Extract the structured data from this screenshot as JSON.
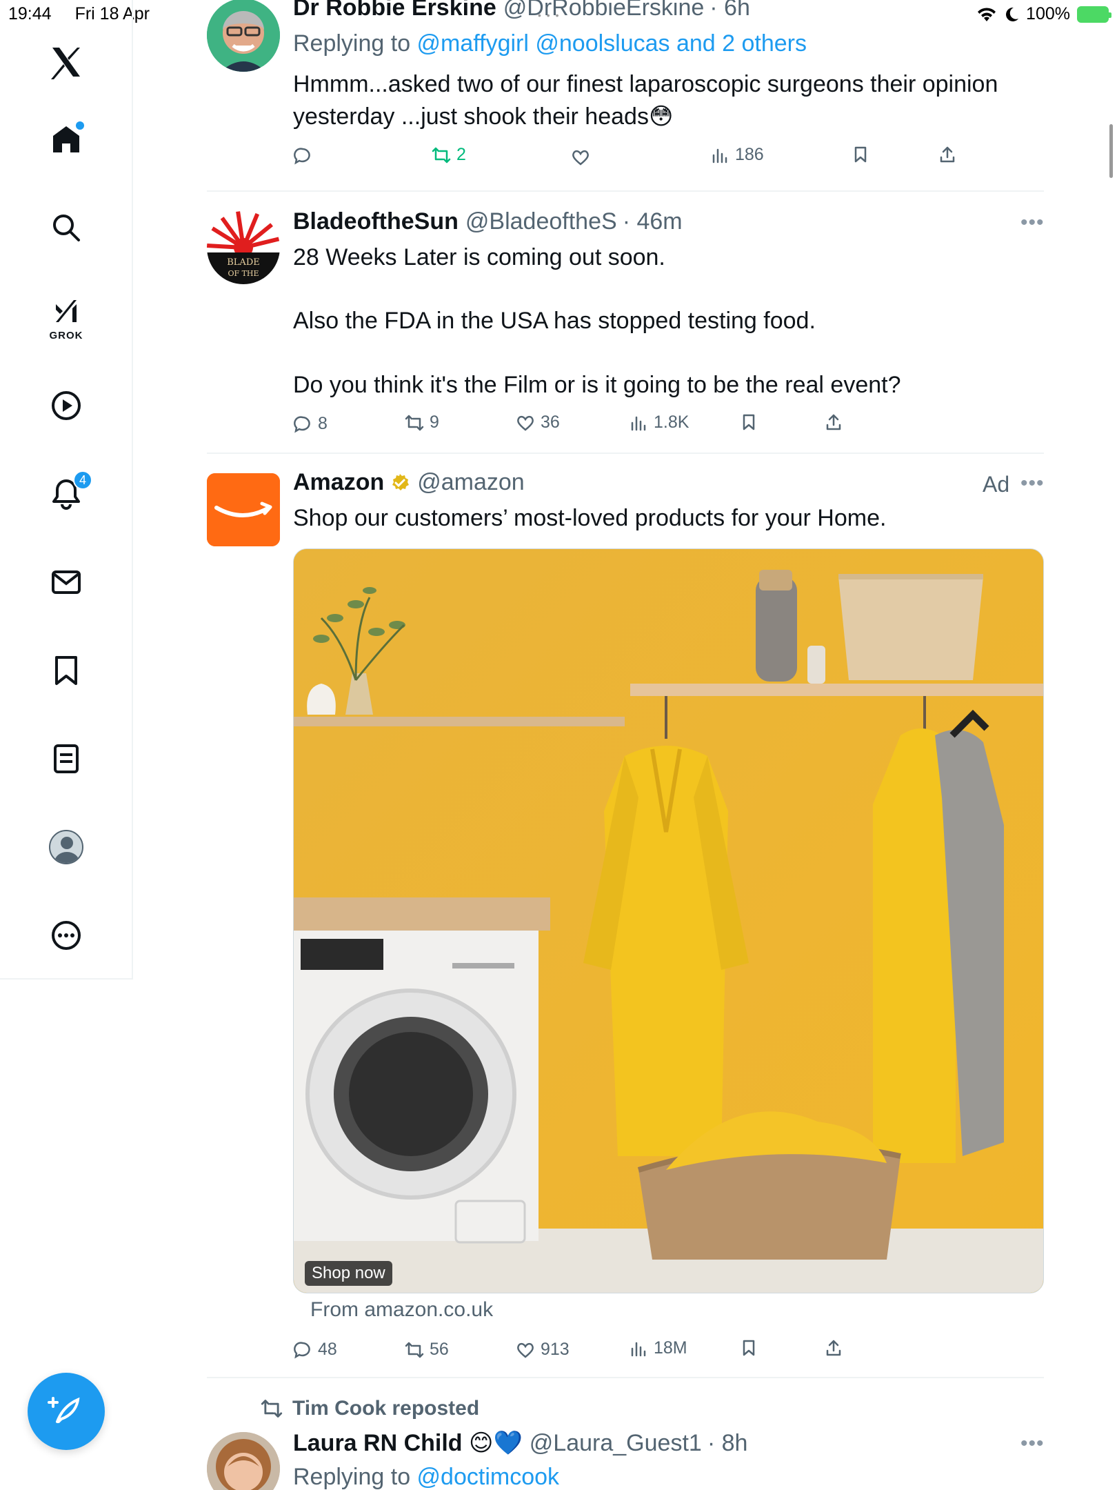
{
  "status_bar": {
    "time": "19:44",
    "date": "Fri 18 Apr",
    "battery": "100%"
  },
  "sidebar": {
    "grok_label": "GROK",
    "notifications_count": "4",
    "items": [
      "x-logo",
      "home",
      "search",
      "grok",
      "video",
      "notifications",
      "messages",
      "bookmarks",
      "lists",
      "profile",
      "more"
    ]
  },
  "tweets": [
    {
      "name": "Dr Robbie Erskine",
      "handle": "@DrRobbieErskine",
      "time": "· 6h",
      "replying_prefix": "Replying to ",
      "replying_to": "@maffygirl @noolslucas and 2 others",
      "lines": [
        "Hmmm...asked two of our finest laparoscopic surgeons their opinion",
        "yesterday ...just shook their heads😳"
      ],
      "replies": "",
      "reposts": "2",
      "likes": "",
      "views": "186"
    },
    {
      "name": "BladeoftheSun",
      "handle": "@BladeoftheS",
      "time": "· 46m",
      "lines": [
        "28 Weeks Later is coming out soon.",
        "Also the FDA in the USA has stopped testing food.",
        "Do you think it's the Film or is it going to be the real event?"
      ],
      "replies": "8",
      "reposts": "9",
      "likes": "36",
      "views": "1.8K"
    },
    {
      "name": "Amazon",
      "handle": "@amazon",
      "ad_label": "Ad",
      "lines": [
        "Shop our customers’ most-loved products for your Home."
      ],
      "shop_now": "Shop now",
      "from": "From amazon.co.uk",
      "replies": "48",
      "reposts": "56",
      "likes": "913",
      "views": "18M"
    },
    {
      "reposted_by": "Tim Cook reposted",
      "name": "Laura RN Child 😊💙",
      "handle": "@Laura_Guest1",
      "time": "· 8h",
      "replying_prefix": "Replying to ",
      "replying_to": "@doctimcook"
    }
  ],
  "colors": {
    "accent": "#1d9bf0",
    "repost_green": "#00ba7c",
    "amazon_orange": "#ff6a13",
    "wall_yellow": "#f1b62c"
  }
}
